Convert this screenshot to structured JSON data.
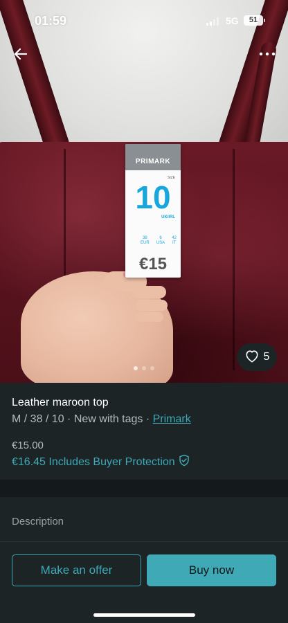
{
  "status_bar": {
    "time": "01:59",
    "network": "5G",
    "battery": "51"
  },
  "photo": {
    "tag_brand": "PRIMARK",
    "tag_size_label": "SIZE",
    "tag_size": "10",
    "tag_uk_label": "UK/IRL",
    "tag_sizes": [
      {
        "value": "38",
        "region": "EUR"
      },
      {
        "value": "6",
        "region": "USA"
      },
      {
        "value": "42",
        "region": "IT"
      }
    ],
    "tag_price": "€15",
    "image_count": 3,
    "active_image": 0,
    "favorites_count": "5"
  },
  "item": {
    "title": "Leather maroon top",
    "details": "M / 38 / 10 · New with tags · ",
    "brand": "Primark",
    "price": "€15.00",
    "buyer_price": "€16.45 Includes Buyer Protection"
  },
  "description_label": "Description",
  "actions": {
    "offer_label": "Make an offer",
    "buy_label": "Buy now"
  },
  "colors": {
    "accent": "#3fa9b6",
    "background": "#1c2426"
  }
}
